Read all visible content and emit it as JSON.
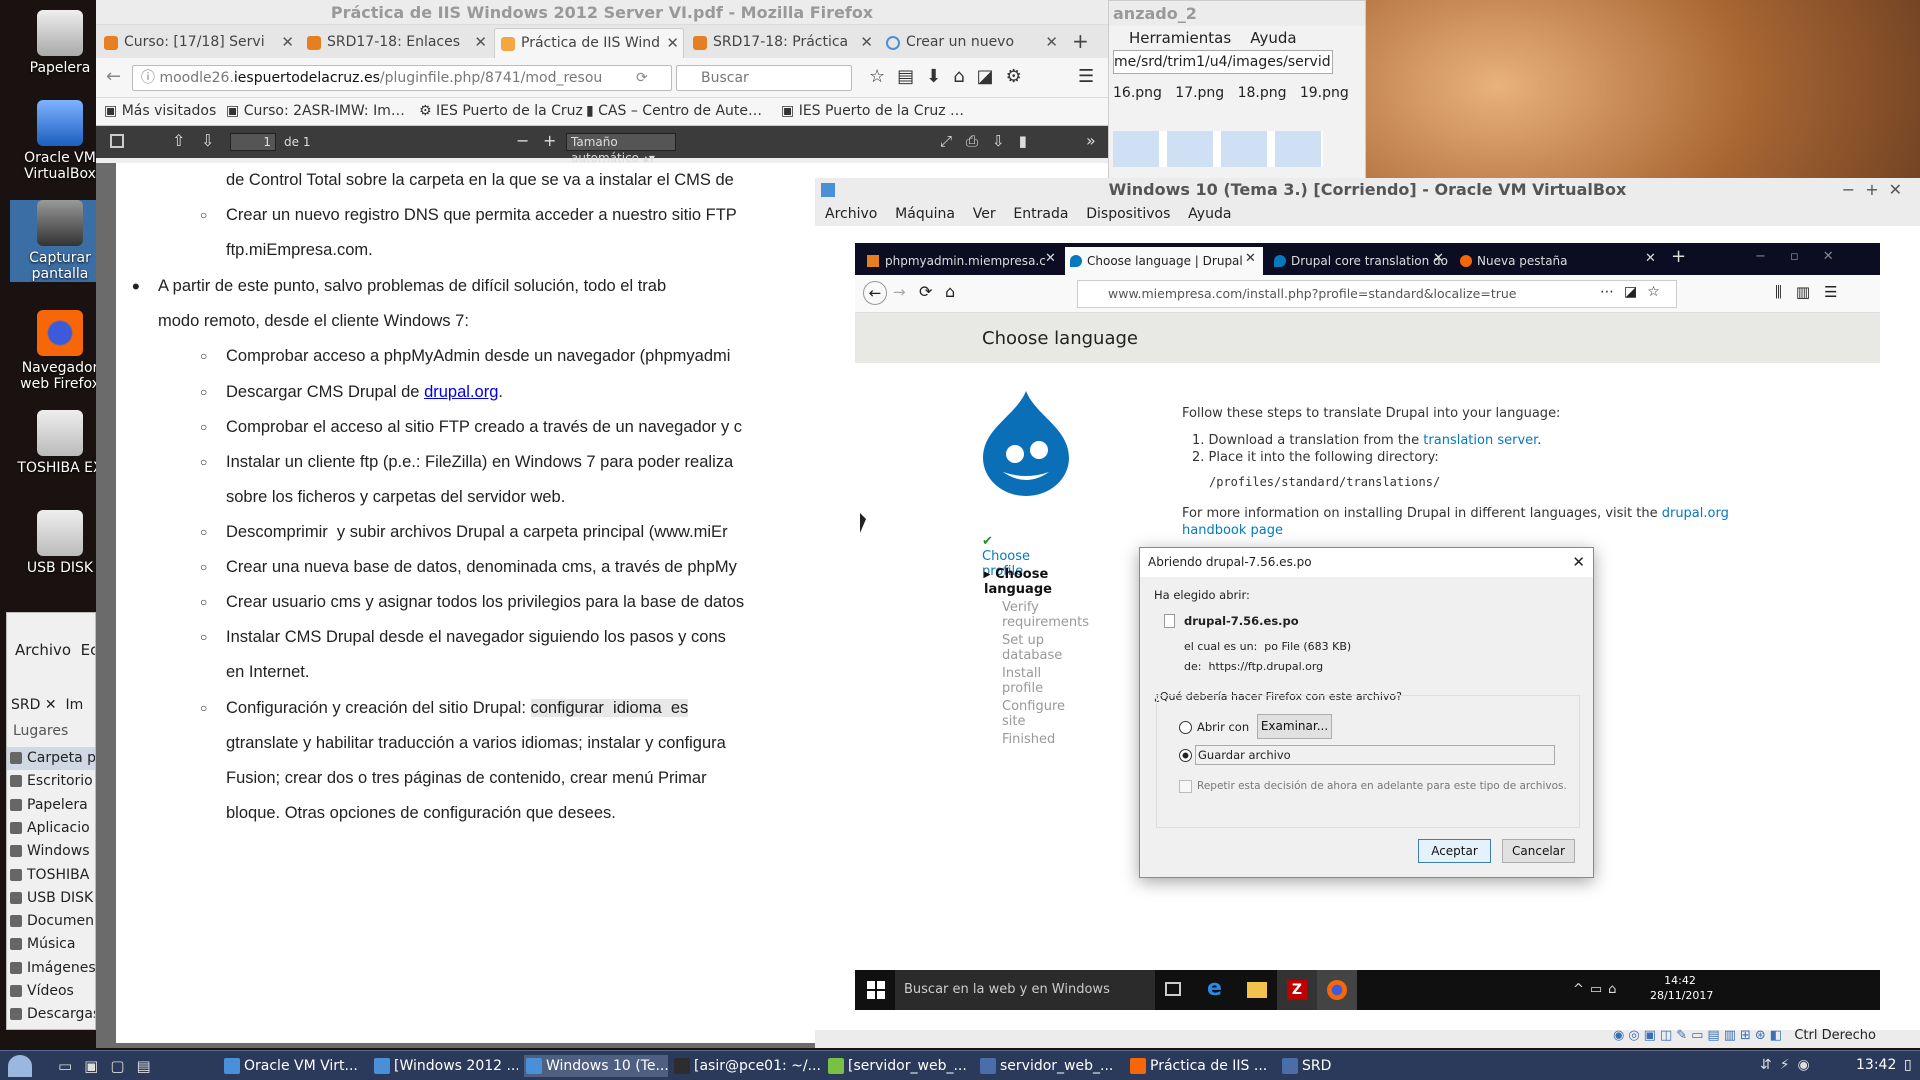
{
  "desktop": {
    "icons": [
      "Papelera",
      "Oracle VM VirtualBox",
      "Capturar pantalla",
      "Navegador web Firefox",
      "TOSHIBA EX",
      "USB DISK"
    ]
  },
  "firefox": {
    "title": "Práctica de IIS Windows 2012 Server VI.pdf - Mozilla Firefox",
    "tabs": [
      "Curso: [17/18] Servi",
      "SRD17-18: Enlaces c",
      "Práctica de IIS Wind",
      "SRD17-18: Práctica",
      "Crear un nuevo usu"
    ],
    "url_prefix": "moodle26.",
    "url_host": "iespuertodelacruz.es",
    "url_path": "/pluginfile.php/8741/mod_resou",
    "search_placeholder": "Buscar",
    "bookmarks": [
      "Más visitados",
      "Curso: 2ASR-IMW: Im…",
      "IES Puerto de la Cruz",
      "CAS – Centro de Aute…",
      "IES Puerto de la Cruz …"
    ],
    "pdf": {
      "page": "1",
      "of": "de 1",
      "zoom": "Tamaño automático"
    }
  },
  "pdf_lines": [
    "de Control Total sobre la carpeta en la que se va a instalar el CMS de",
    "Crear un nuevo registro DNS que permita acceder a nuestro sitio FTP",
    "ftp.miEmpresa.com.",
    "A partir de este punto, salvo problemas de difícil solución, todo el trab",
    "modo remoto, desde el cliente Windows 7:",
    "Comprobar acceso a phpMyAdmin desde un navegador (phpmyadmi",
    "Descargar  CMS Drupal de ",
    "Comprobar el acceso al sitio FTP creado a través de un navegador y c",
    "Instalar un cliente ftp (p.e.: FileZilla) en Windows 7 para poder realiza",
    "sobre los ficheros y carpetas del servidor web.",
    "Descomprimir  y subir archivos Drupal a carpeta principal (www.miEr",
    "Crear una nueva base de datos, denominada cms, a través de phpMy",
    "Crear usuario cms y asignar todos los privilegios para la base de datos",
    "Instalar CMS Drupal desde el navegador siguiendo los pasos y cons",
    "en Internet.",
    "Configuración  y  creación  del  sitio  Drupal:  ",
    "gtranslate y habilitar traducción a varios idiomas; instalar y configura",
    "Fusion; crear dos o tres páginas de contenido, crear menú Primar",
    "bloque. Otras opciones de configuración que desees."
  ],
  "pdf_link": "drupal.org",
  "pdf_highlight": "configurar  idioma  es",
  "filemgr": {
    "title": "anzado_2",
    "menu": [
      "Herramientas",
      "Ayuda"
    ],
    "path": "me/srd/trim1/u4/images/servid",
    "files": [
      "16.png",
      "17.png",
      "18.png",
      "19.png"
    ]
  },
  "sidepanel": {
    "menu": [
      "Archivo",
      "Ec"
    ],
    "tabs": [
      "SRD",
      "Im"
    ],
    "heading": "Lugares",
    "items": [
      "Carpeta p",
      "Escritorio",
      "Papelera",
      "Aplicacio",
      "Windows",
      "TOSHIBA",
      "USB DISK",
      "Documen",
      "Música",
      "Imágenes",
      "Vídeos",
      "Descargas"
    ]
  },
  "vbox": {
    "title": "Windows 10 (Tema 3.) [Corriendo] - Oracle VM VirtualBox",
    "menu": [
      "Archivo",
      "Máquina",
      "Ver",
      "Entrada",
      "Dispositivos",
      "Ayuda"
    ],
    "host_key": "Ctrl Derecho"
  },
  "guest_ff": {
    "tabs": [
      "phpmyadmin.miempresa.c",
      "Choose language | Drupal",
      "Drupal core translation do",
      "Nueva pestaña"
    ],
    "url": "www.miempresa.com/install.php?profile=standard&localize=true"
  },
  "drupal": {
    "heading": "Choose language",
    "steps": [
      "Choose profile",
      "Choose language",
      "Verify requirements",
      "Set up database",
      "Install profile",
      "Configure site",
      "Finished"
    ],
    "intro": "Follow these steps to translate Drupal into your language:",
    "step1_pre": "Download a translation from the ",
    "step1_link": "translation server",
    "step1_post": ".",
    "step2": "Place it into the following directory:",
    "dir": "/profiles/standard/translations/",
    "more_pre": "For more information on installing Drupal in different languages, visit the ",
    "more_link": "drupal.org",
    "more_link2": "handbook page"
  },
  "dialog": {
    "title": "Abriendo drupal-7.56.es.po",
    "chosen": "Ha elegido abrir:",
    "filename": "drupal-7.56.es.po",
    "type_label": "el cual es un:",
    "type_value": "po File (683 KB)",
    "from_label": "de:",
    "from_value": "https://ftp.drupal.org",
    "question": "¿Qué debería hacer Firefox con este archivo?",
    "open_with": "Abrir con",
    "browse": "Examinar...",
    "save": "Guardar archivo",
    "remember": "Repetir esta decisión de ahora en adelante para este tipo de archivos.",
    "ok": "Aceptar",
    "cancel": "Cancelar"
  },
  "win10": {
    "search": "Buscar en la web y en Windows",
    "time": "14:42",
    "date": "28/11/2017"
  },
  "taskbar": {
    "items": [
      "Oracle VM Virt...",
      "[Windows 2012 ...",
      "Windows 10 (Te...",
      "[asir@pce01: ~/...",
      "[servidor_web_...",
      "servidor_web_...",
      "Práctica de IIS ...",
      "SRD"
    ],
    "clock": "13:42"
  }
}
